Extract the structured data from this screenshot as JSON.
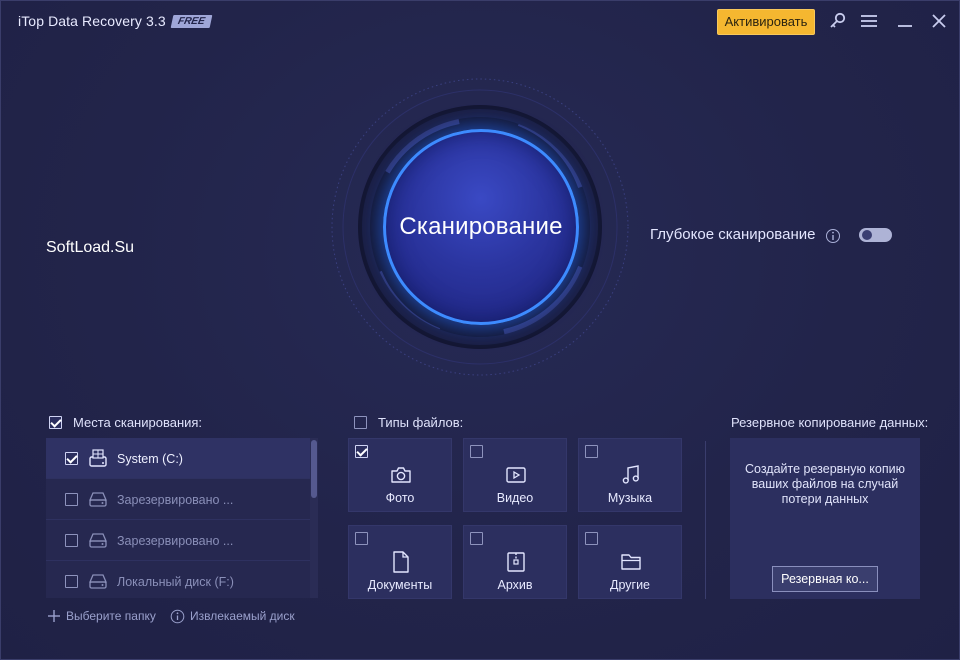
{
  "window": {
    "title": "iTop Data Recovery 3.3",
    "badge": "FREE",
    "activate_label": "Активировать",
    "icons": [
      "key-icon",
      "menu-icon",
      "minimize-icon",
      "close-icon"
    ]
  },
  "scan": {
    "label": "Сканирование"
  },
  "watermark": "SoftLoad.Su",
  "deep_scan": {
    "label": "Глубокое сканирование",
    "enabled": false
  },
  "scan_places": {
    "header": "Места сканирования:",
    "header_checked": true,
    "items": [
      {
        "label": "System (C:)",
        "checked": true,
        "icon": "windows-drive-icon"
      },
      {
        "label": "Зарезервировано ...",
        "checked": false,
        "icon": "drive-icon"
      },
      {
        "label": "Зарезервировано ...",
        "checked": false,
        "icon": "drive-icon"
      },
      {
        "label": "Локальный диск (F:)",
        "checked": false,
        "icon": "drive-icon"
      }
    ],
    "choose_folder": "Выберите папку",
    "removable_disk": "Извлекаемый диск"
  },
  "file_types": {
    "header": "Типы файлов:",
    "header_checked": false,
    "items": [
      {
        "label": "Фото",
        "checked": true,
        "icon": "camera-icon"
      },
      {
        "label": "Видео",
        "checked": false,
        "icon": "video-icon"
      },
      {
        "label": "Музыка",
        "checked": false,
        "icon": "music-icon"
      },
      {
        "label": "Документы",
        "checked": false,
        "icon": "document-icon"
      },
      {
        "label": "Архив",
        "checked": false,
        "icon": "archive-icon"
      },
      {
        "label": "Другие",
        "checked": false,
        "icon": "folder-icon"
      }
    ]
  },
  "backup": {
    "header": "Резервное копирование данных:",
    "text": "Создайте резервную копию ваших файлов на случай потери данных",
    "button": "Резервная ко..."
  },
  "colors": {
    "background": "#22244a",
    "accent_blue": "#3d8bff",
    "activate": "#f5b730"
  }
}
